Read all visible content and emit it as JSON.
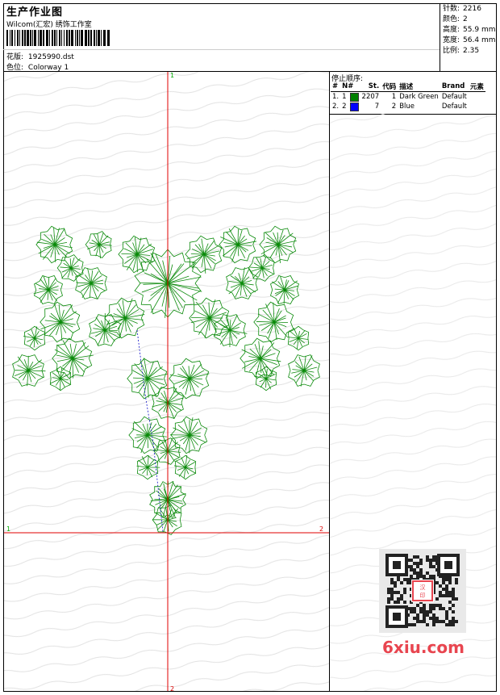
{
  "header": {
    "title": "生产作业图",
    "company": "Wilcom(汇宏) 绣饰工作室",
    "design_label": "花版:",
    "design_value": "1925990.dst",
    "color_label": "色位:",
    "color_value": "Colorway 1"
  },
  "stats": [
    {
      "label": "针数:",
      "value": "2216"
    },
    {
      "label": "颜色:",
      "value": "2"
    },
    {
      "label": "高度:",
      "value": "55.9 mm"
    },
    {
      "label": "宽度:",
      "value": "56.4 mm"
    },
    {
      "label": "比例:",
      "value": "2.35"
    }
  ],
  "stop_sequence": {
    "title": "停止顺序:",
    "headers": [
      "#",
      "N#",
      "St.",
      "代码",
      "描述",
      "Brand",
      "元素"
    ],
    "rows": [
      {
        "idx": "1.",
        "n": "1",
        "st": "2207",
        "code": "1",
        "desc": "Dark Green",
        "brand": "Default",
        "color": "#008000"
      },
      {
        "idx": "2.",
        "n": "2",
        "st": "7",
        "code": "2",
        "desc": "Blue",
        "brand": "Default",
        "color": "#0000ff"
      }
    ]
  },
  "axis_labels": {
    "top": "1",
    "bottom": "2",
    "left": "1",
    "right": "2"
  },
  "colors": {
    "thread_green": "#0a8a0a",
    "thread_blue": "#1010c8",
    "axis_red": "#e00000",
    "brand_red": "#e8454f"
  },
  "watermark": "6xiu.com"
}
